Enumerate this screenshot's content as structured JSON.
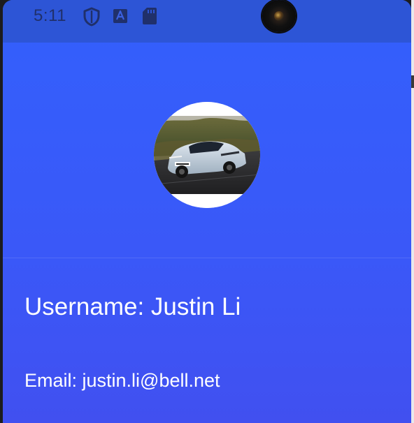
{
  "status_bar": {
    "time": "5:11",
    "icons": [
      "shield-icon",
      "a-box-icon",
      "sd-card-icon"
    ],
    "color": "#2d55d6"
  },
  "profile": {
    "avatar_image": "car-photo",
    "username_text": "Username: Justin Li",
    "email_text": "Email: justin.li@bell.net"
  },
  "colors": {
    "background_top": "#3360fc",
    "background_bottom": "#4150f0",
    "text": "#ffffff"
  }
}
